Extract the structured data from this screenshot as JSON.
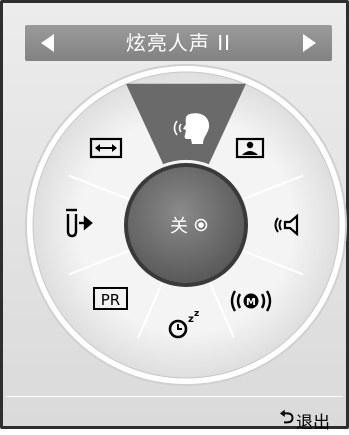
{
  "header": {
    "title": "炫亮人声 II"
  },
  "center": {
    "label": "关"
  },
  "footer": {
    "exit_label": "退出",
    "exit_icon": "return-arrow-icon"
  },
  "wheel_items": [
    {
      "name": "clear-voice-icon",
      "selected": true
    },
    {
      "name": "picture-mode-icon"
    },
    {
      "name": "sound-mode-icon"
    },
    {
      "name": "surround-sound-icon"
    },
    {
      "name": "sleep-timer-icon"
    },
    {
      "name": "program-list-icon"
    },
    {
      "name": "input-source-icon"
    },
    {
      "name": "aspect-ratio-icon"
    }
  ],
  "colors": {
    "selected_segment": "#6a6a6a",
    "center": "#6f6f6f"
  }
}
